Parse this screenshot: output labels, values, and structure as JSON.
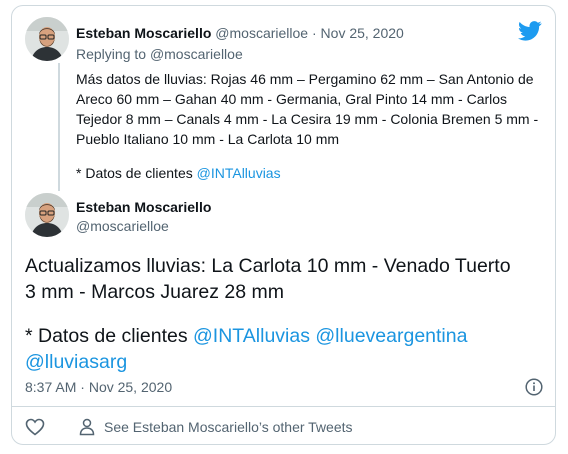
{
  "colors": {
    "accent": "#1b95e0",
    "muted": "#536471",
    "text": "#0f1419",
    "border": "#cfd9de"
  },
  "reply_tweet": {
    "display_name": "Esteban Moscariello",
    "handle": "@moscarielloe",
    "separator": "·",
    "date": "Nov 25, 2020",
    "replying_prefix": "Replying to",
    "replying_handle": "@moscarielloe",
    "text": "Más datos de lluvias: Rojas 46 mm – Pergamino 62 mm – San Antonio de Areco 60 mm – Gahan 40 mm - Germania, Gral Pinto 14 mm - Carlos Tejedor 8 mm – Canals 4 mm - La Cesira 19 mm - Colonia Bremen 5 mm - Pueblo Italiano 10 mm - La Carlota 10 mm",
    "footnote_prefix": "* Datos de clientes",
    "footnote_mention": "@INTAlluvias"
  },
  "main_tweet": {
    "display_name": "Esteban Moscariello",
    "handle": "@moscarielloe",
    "text": "Actualizamos lluvias: La Carlota 10 mm - Venado Tuerto 3 mm - Marcos Juarez 28 mm",
    "footnote_prefix": "* Datos de clientes",
    "mention_1": "@INTAlluvias",
    "mention_2": "@llueveargentina",
    "mention_3": "@lluviasarg",
    "time": "8:37 AM",
    "separator": "·",
    "date": "Nov 25, 2020"
  },
  "footer": {
    "other_tweets_label": "See Esteban Moscariello’s other Tweets"
  },
  "icons": {
    "logo": "twitter-bird-icon",
    "info": "info-icon",
    "like": "heart-icon",
    "profile": "person-icon"
  }
}
